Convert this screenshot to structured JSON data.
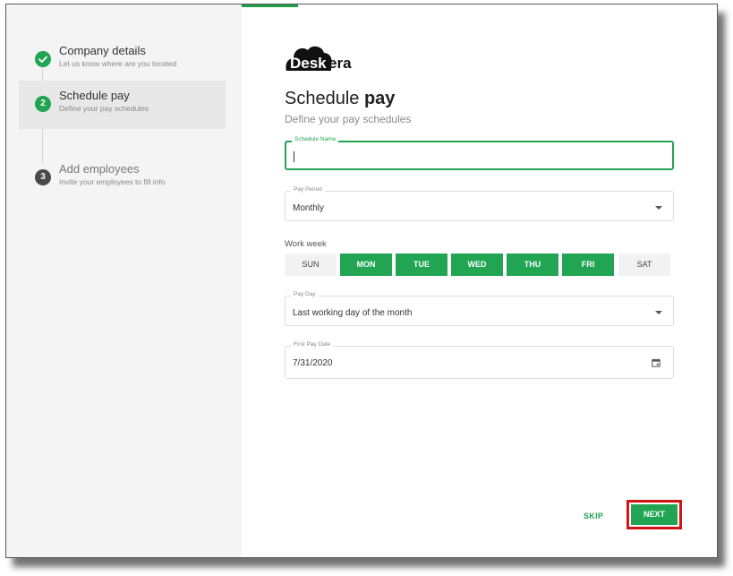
{
  "brand": {
    "logo_part1": "Desk",
    "logo_part2": "era"
  },
  "steps": [
    {
      "title": "Company details",
      "subtitle": "Let us know where are you located",
      "state": "done",
      "number": ""
    },
    {
      "title": "Schedule pay",
      "subtitle": "Define your pay schedules",
      "state": "active",
      "number": "2"
    },
    {
      "title": "Add employees",
      "subtitle": "Invite your employees to fill info",
      "state": "todo",
      "number": "3"
    }
  ],
  "form": {
    "title_regular": "Schedule ",
    "title_bold": "pay",
    "subtitle": "Define your pay schedules",
    "schedule_name": {
      "label": "Schedule Name",
      "value": ""
    },
    "pay_period": {
      "label": "Pay Period",
      "value": "Monthly"
    },
    "work_week": {
      "label": "Work week",
      "days": [
        {
          "label": "SUN",
          "selected": false
        },
        {
          "label": "MON",
          "selected": true
        },
        {
          "label": "TUE",
          "selected": true
        },
        {
          "label": "WED",
          "selected": true
        },
        {
          "label": "THU",
          "selected": true
        },
        {
          "label": "FRI",
          "selected": true
        },
        {
          "label": "SAT",
          "selected": false
        }
      ]
    },
    "pay_day": {
      "label": "Pay Day",
      "value": "Last working day of the month"
    },
    "first_pay_date": {
      "label": "First Pay Date",
      "value": "7/31/2020"
    }
  },
  "actions": {
    "skip": "SKIP",
    "next": "NEXT"
  },
  "colors": {
    "accent": "#21a552",
    "highlight": "#d21414"
  }
}
